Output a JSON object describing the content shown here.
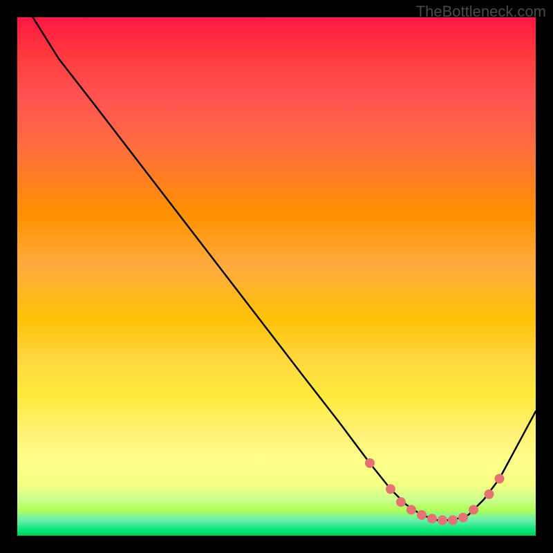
{
  "watermark": "TheBottleneck.com",
  "chart_data": {
    "type": "line",
    "title": "",
    "xlabel": "",
    "ylabel": "",
    "xlim": [
      0,
      100
    ],
    "ylim": [
      0,
      100
    ],
    "series": [
      {
        "name": "bottleneck-curve",
        "x": [
          3,
          8,
          15,
          25,
          35,
          45,
          55,
          62,
          68,
          72,
          75,
          78,
          81,
          84,
          87,
          90,
          93,
          100
        ],
        "y": [
          100,
          92,
          83,
          70,
          57,
          44,
          31,
          22,
          14,
          9,
          6,
          4,
          3,
          3,
          4,
          7,
          11,
          24
        ]
      }
    ],
    "markers": {
      "name": "highlight-points",
      "color": "#e57373",
      "points": [
        {
          "x": 68,
          "y": 14
        },
        {
          "x": 72,
          "y": 9
        },
        {
          "x": 74,
          "y": 6.5
        },
        {
          "x": 76,
          "y": 5
        },
        {
          "x": 78,
          "y": 4
        },
        {
          "x": 80,
          "y": 3.3
        },
        {
          "x": 82,
          "y": 3
        },
        {
          "x": 84,
          "y": 3
        },
        {
          "x": 86,
          "y": 3.5
        },
        {
          "x": 88,
          "y": 5
        },
        {
          "x": 91,
          "y": 8
        },
        {
          "x": 93,
          "y": 11
        }
      ]
    },
    "gradient_stops": [
      {
        "offset": 0,
        "color": "#ff1744"
      },
      {
        "offset": 50,
        "color": "#ffc107"
      },
      {
        "offset": 85,
        "color": "#ffeb3b"
      },
      {
        "offset": 100,
        "color": "#00c853"
      }
    ]
  }
}
